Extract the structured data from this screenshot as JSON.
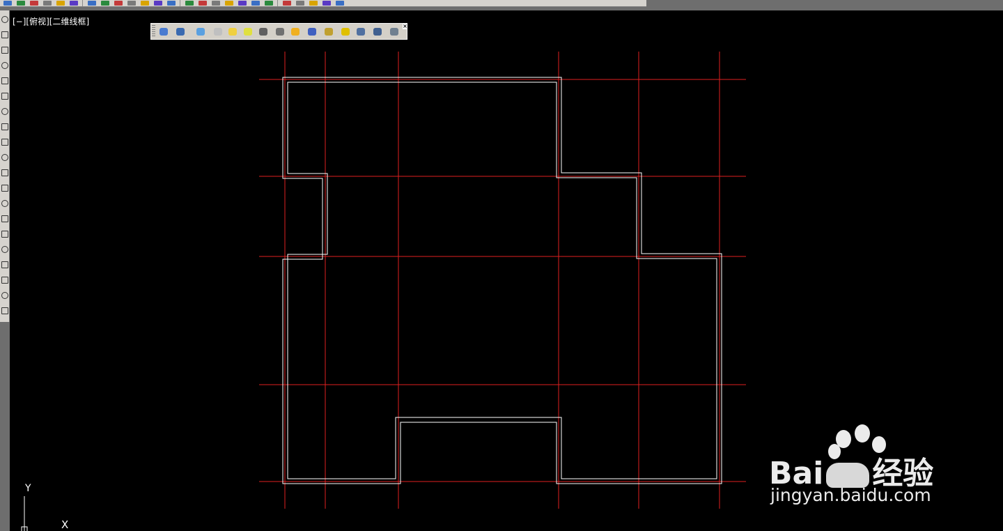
{
  "viewport": {
    "label": "[−][俯视][二维线框]"
  },
  "ucs": {
    "y_label": "Y",
    "x_label": "X"
  },
  "watermark": {
    "brand": "Bai",
    "brand_suffix": "经验",
    "url": "jingyan.baidu.com"
  },
  "layers_toolbar": {
    "close_glyph": "×",
    "icons": [
      "layer-manager-icon",
      "layer-previous-icon",
      "layer-off-icon",
      "layer-isolate-icon",
      "layer-on-icon",
      "layer-freeze-icon",
      "layer-thaw-icon",
      "layer-unfreeze-all-icon",
      "layer-bulb-icon",
      "layer-lock-icon",
      "layer-unlock-icon",
      "layer-match-icon",
      "layer-walk-icon",
      "layer-merge-icon",
      "layer-delete-icon"
    ]
  },
  "main_toolbar": {
    "icons": [
      "save-icon",
      "print-icon",
      "undo-icon",
      "redo-icon",
      "pan-icon",
      "zoom-icon",
      "properties-icon",
      "dimension-linear-icon",
      "dimension-aligned-icon",
      "dimension-radius-icon",
      "dimension-angular-icon",
      "measure-icon",
      "circle-icon",
      "table-icon",
      "block-icon",
      "insert-icon",
      "attribute-icon",
      "layout-icon",
      "viewport-icon",
      "plot-icon",
      "calculator-icon",
      "markup-icon",
      "publish-icon",
      "sheet-icon",
      "help-icon"
    ]
  },
  "colors": {
    "grid_axis": "#e02020",
    "wall": "#ffffff",
    "canvas": "#000000"
  }
}
